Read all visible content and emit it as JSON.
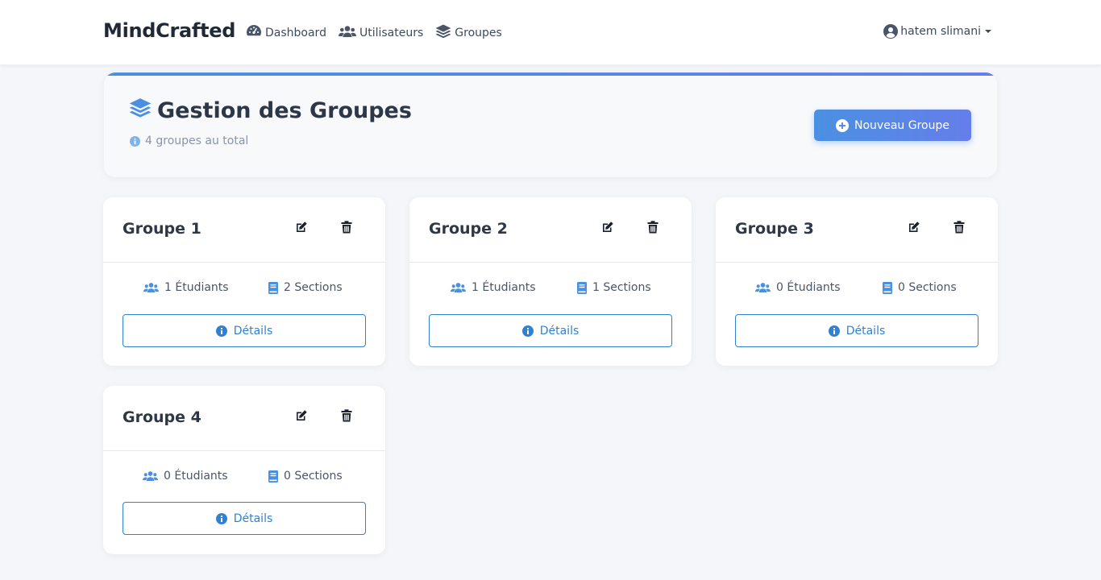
{
  "navbar": {
    "brand": "MindCrafted",
    "links": [
      {
        "label": "Dashboard",
        "icon": "gauge-icon"
      },
      {
        "label": "Utilisateurs",
        "icon": "users-icon"
      },
      {
        "label": "Groupes",
        "icon": "layers-icon"
      }
    ],
    "user": {
      "name": "hatem slimani",
      "icon": "user-circle-icon"
    }
  },
  "header": {
    "title": "Gestion des Groupes",
    "subtitle": "4 groupes au total",
    "new_button": "Nouveau Groupe"
  },
  "groups": [
    {
      "name": "Groupe 1",
      "students": "1 Étudiants",
      "sections": "2 Sections",
      "details": "Détails"
    },
    {
      "name": "Groupe 2",
      "students": "1 Étudiants",
      "sections": "1 Sections",
      "details": "Détails"
    },
    {
      "name": "Groupe 3",
      "students": "0 Étudiants",
      "sections": "0 Sections",
      "details": "Détails"
    },
    {
      "name": "Groupe 4",
      "students": "0 Étudiants",
      "sections": "0 Sections",
      "details": "Détails"
    }
  ],
  "colors": {
    "accent": "#4a90e2",
    "accent_end": "#667eea",
    "details": "#3182ce"
  }
}
